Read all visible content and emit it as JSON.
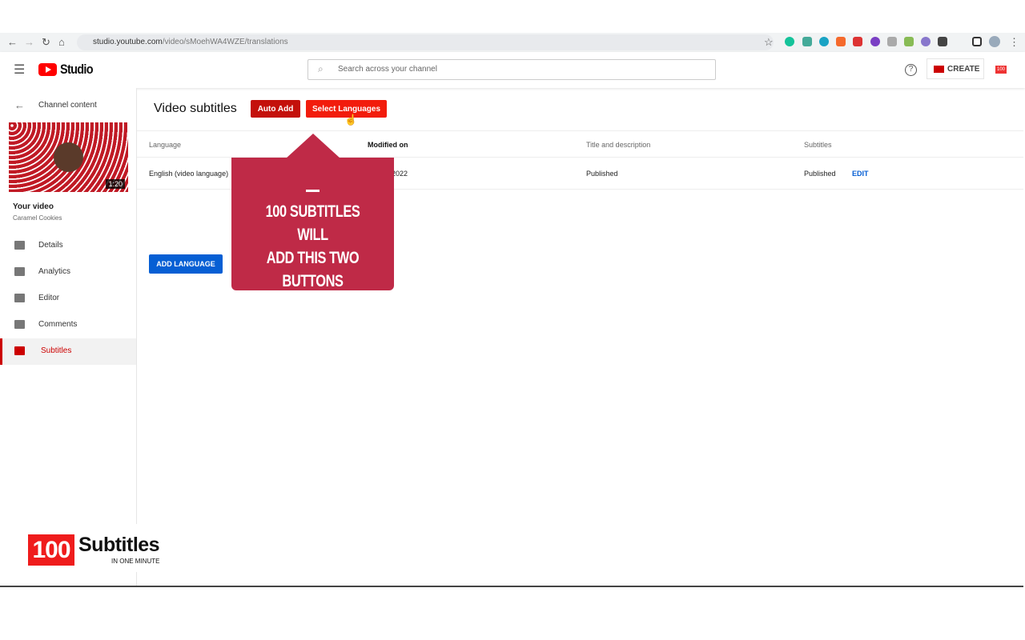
{
  "browser": {
    "url_host": "studio.youtube.com",
    "url_path": "/video/sMoehWA4WZE/translations"
  },
  "header": {
    "logo_text": "Studio",
    "search_placeholder": "Search across your channel",
    "create_label": "CREATE",
    "badge": "100"
  },
  "sidebar": {
    "back_label": "Channel content",
    "video_duration": "1:20",
    "your_video_label": "Your video",
    "video_title": "Caramel Cookies",
    "items": [
      {
        "label": "Details",
        "icon": "pencil-icon"
      },
      {
        "label": "Analytics",
        "icon": "analytics-icon"
      },
      {
        "label": "Editor",
        "icon": "editor-icon"
      },
      {
        "label": "Comments",
        "icon": "comments-icon"
      },
      {
        "label": "Subtitles",
        "icon": "subtitles-icon",
        "active": true
      }
    ]
  },
  "main": {
    "title": "Video subtitles",
    "auto_add_label": "Auto Add",
    "select_languages_label": "Select Languages",
    "columns": [
      "Language",
      "Modified on",
      "Title and description",
      "Subtitles"
    ],
    "rows": [
      {
        "language": "English (video language)",
        "modified": "2022",
        "title_desc": "Published",
        "subtitles": "Published",
        "action": "EDIT"
      }
    ],
    "add_language_label": "ADD LANGUAGE"
  },
  "overlay": {
    "line1": "100 SUBTITLES WILL",
    "line2": "ADD THIS TWO BUTTONS"
  },
  "watermark": {
    "number": "100",
    "word": "Subtitles",
    "tagline": "IN ONE MINUTE"
  },
  "colors": {
    "accent_red": "#cc0000",
    "select_red": "#f21c0c",
    "blue": "#065fd4",
    "overlay": "#bf2a47"
  }
}
